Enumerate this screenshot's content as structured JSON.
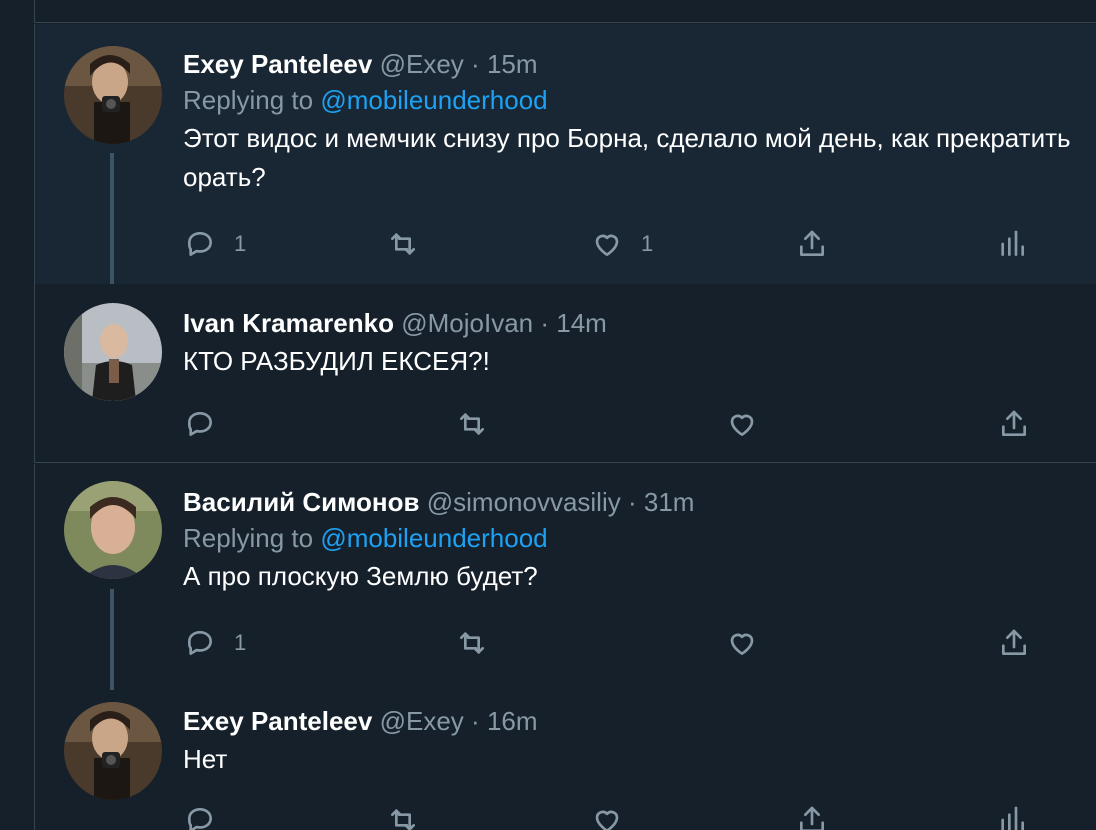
{
  "tweets": [
    {
      "author": "Exey Panteleev",
      "handle": "@Exey",
      "time": "15m",
      "replying_prefix": "Replying to ",
      "replying_to": "@mobileunderhood",
      "text": "Этот видос и мемчик снизу про Борна, сделало мой день, как прекратить орать?",
      "reply_count": "1",
      "retweet_count": "",
      "like_count": "1"
    },
    {
      "author": "Ivan Kramarenko",
      "handle": "@MojoIvan",
      "time": "14m",
      "text": "КТО РАЗБУДИЛ ЕКСЕЯ?!",
      "reply_count": "",
      "retweet_count": "",
      "like_count": ""
    },
    {
      "author": "Василий Симонов",
      "handle": "@simonovvasiliy",
      "time": "31m",
      "replying_prefix": "Replying to ",
      "replying_to": "@mobileunderhood",
      "text": "А про плоскую Землю будет?",
      "reply_count": "1",
      "retweet_count": "",
      "like_count": ""
    },
    {
      "author": "Exey Panteleev",
      "handle": "@Exey",
      "time": "16m",
      "text": "Нет",
      "reply_count": "",
      "retweet_count": "",
      "like_count": ""
    }
  ],
  "separator": "·",
  "icons": [
    "reply-icon",
    "retweet-icon",
    "like-icon",
    "share-icon",
    "analytics-icon"
  ],
  "colors": {
    "background": "#15202b",
    "highlight": "#192734",
    "muted": "#8899a6",
    "link": "#1da1f2",
    "border": "#38444d"
  }
}
